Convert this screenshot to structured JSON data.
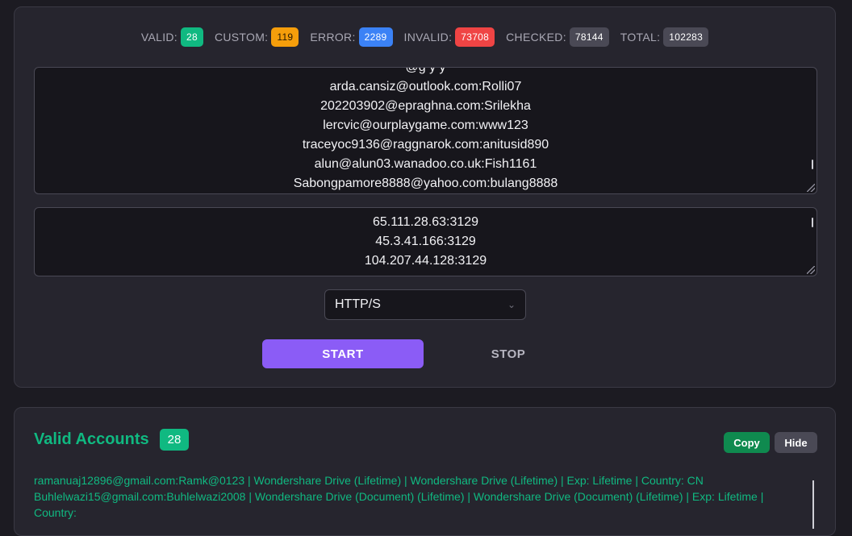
{
  "stats": [
    {
      "label": "VALID:",
      "value": "28",
      "color": "#10b981"
    },
    {
      "label": "CUSTOM:",
      "value": "119",
      "color": "#f59e0b"
    },
    {
      "label": "ERROR:",
      "value": "2289",
      "color": "#3b82f6"
    },
    {
      "label": "INVALID:",
      "value": "73708",
      "color": "#ef4444"
    },
    {
      "label": "CHECKED:",
      "value": "78144",
      "color": "#4a4955"
    },
    {
      "label": "TOTAL:",
      "value": "102283",
      "color": "#4a4955"
    }
  ],
  "combos": {
    "lines": [
      "@g          y  y",
      "arda.cansiz@outlook.com:Rolli07",
      "202203902@epraghna.com:Srilekha",
      "lercvic@ourplaygame.com:www123",
      "traceyoc9136@raggnarok.com:anitusid890",
      "alun@alun03.wanadoo.co.uk:Fish1161",
      "Sabongpamore8888@yahoo.com:bulang8888"
    ]
  },
  "proxies": {
    "lines": [
      "65.111.28.63:3129",
      "45.3.41.166:3129",
      "104.207.44.128:3129"
    ]
  },
  "proxy_type": {
    "selected": "HTTP/S"
  },
  "controls": {
    "start_label": "START",
    "stop_label": "STOP"
  },
  "valid": {
    "title": "Valid Accounts",
    "count": "28",
    "copy_label": "Copy",
    "hide_label": "Hide",
    "lines": [
      "ramanuaj12896@gmail.com:Ramk@0123 | Wondershare Drive (Lifetime) | Wondershare Drive (Lifetime) | Exp: Lifetime | Country: CN",
      "Buhlelwazi15@gmail.com:Buhlelwazi2008 | Wondershare Drive (Document) (Lifetime) | Wondershare Drive (Document) (Lifetime) | Exp: Lifetime |",
      "Country:"
    ]
  }
}
